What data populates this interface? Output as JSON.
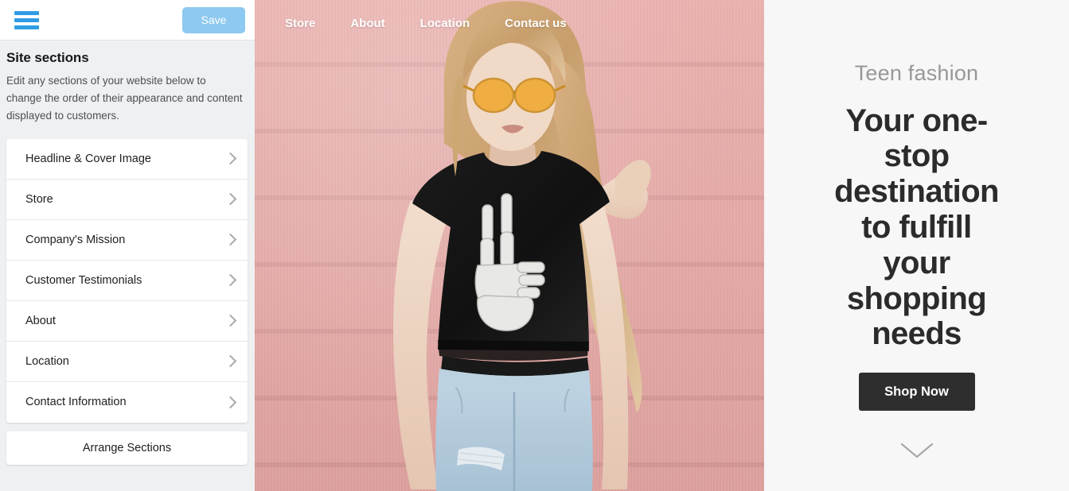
{
  "editor": {
    "toolbar": {
      "menu_icon": "hamburger-menu-icon",
      "save_label": "Save"
    },
    "panel": {
      "title": "Site sections",
      "description": "Edit any sections of your website below to change the order of their appearance and content displayed to customers."
    },
    "sections": [
      {
        "label": "Headline & Cover Image",
        "chevron": "chevron-right-icon"
      },
      {
        "label": "Store",
        "chevron": "chevron-right-icon"
      },
      {
        "label": "Company's Mission",
        "chevron": "chevron-right-icon"
      },
      {
        "label": "Customer Testimonials",
        "chevron": "chevron-right-icon"
      },
      {
        "label": "About",
        "chevron": "chevron-right-icon"
      },
      {
        "label": "Location",
        "chevron": "chevron-right-icon"
      },
      {
        "label": "Contact Information",
        "chevron": "chevron-right-icon"
      }
    ],
    "arrange_label": "Arrange Sections"
  },
  "site_preview": {
    "nav": [
      {
        "label": "Store"
      },
      {
        "label": "About"
      },
      {
        "label": "Location"
      },
      {
        "label": "Contact us"
      }
    ],
    "cover_image_alt": "Blonde woman in orange sunglasses wearing a black skeleton peace-sign t-shirt and light ripped jeans, leaning against a pink brick wall",
    "hero": {
      "eyebrow": "Teen fashion",
      "headline": "Your one-stop destination to fulfill your shopping needs",
      "cta_label": "Shop Now",
      "scroll_icon": "chevron-down-icon"
    }
  },
  "colors": {
    "accent_blue": "#2f9de4",
    "save_button_bg": "#8dc9f0",
    "sidebar_bg": "#eff0f2",
    "card_bg": "#ffffff",
    "cta_bg": "#2e2e2e",
    "eyebrow_text": "#989898",
    "headline_text": "#2b2b2b",
    "right_panel_bg": "#f7f7f7",
    "wall_pink": "#e9aaa7"
  }
}
